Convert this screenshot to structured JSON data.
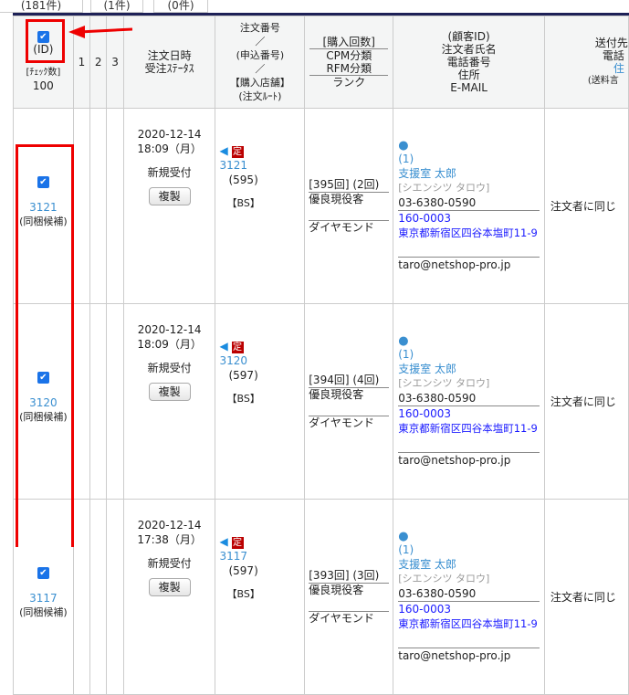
{
  "tabs": [
    {
      "count": "(181件)"
    },
    {
      "count": "(1件)"
    },
    {
      "count": "(0件)"
    }
  ],
  "header": {
    "check_id": "(ID)",
    "check_count_label": "[ﾁｪｯｸ数]",
    "check_count": "100",
    "col1": "1",
    "col2": "2",
    "col3": "3",
    "date_l1": "注文日時",
    "date_l2": "受注ｽﾃｰﾀｽ",
    "ord_l1": "注文番号",
    "ord_sep": "／",
    "ord_l2": "(申込番号)",
    "ord_l3": "【購入店舗】",
    "ord_l4": "(注文ﾙｰﾄ)",
    "buy_l1": "[購入回数]",
    "buy_l2": "CPM分類",
    "buy_l3": "RFM分類",
    "buy_l4": "ランク",
    "cust_l1": "(顧客ID)",
    "cust_l2": "注文者氏名",
    "cust_l3": "電話番号",
    "cust_l4": "住所",
    "cust_l5": "E-MAIL",
    "ship_l1": "送付先",
    "ship_l2": "電話",
    "ship_l3": "住",
    "ship_l4": "(送料言"
  },
  "rows": [
    {
      "id": "3121",
      "bundle": "(同梱候補)",
      "date": "2020-12-14",
      "time": "18:09（月）",
      "status": "新規受付",
      "copy": "複製",
      "tei": "定",
      "order_no": "3121",
      "app_no": "(595)",
      "store": "【BS】",
      "buy_count": "[395回] (2回)",
      "cpm": "優良現役客",
      "rank": "ダイヤモンド",
      "cust_id": "(1)",
      "name": "支援室 太郎",
      "kana": "[シエンシツ タロウ]",
      "tel": "03-6380-0590",
      "zip": "160-0003",
      "addr": "東京都新宿区四谷本塩町11-9",
      "email": "taro@netshop-pro.jp",
      "ship": "注文者に同じ"
    },
    {
      "id": "3120",
      "bundle": "(同梱候補)",
      "date": "2020-12-14",
      "time": "18:09（月）",
      "status": "新規受付",
      "copy": "複製",
      "tei": "定",
      "order_no": "3120",
      "app_no": "(597)",
      "store": "【BS】",
      "buy_count": "[394回] (4回)",
      "cpm": "優良現役客",
      "rank": "ダイヤモンド",
      "cust_id": "(1)",
      "name": "支援室 太郎",
      "kana": "[シエンシツ タロウ]",
      "tel": "03-6380-0590",
      "zip": "160-0003",
      "addr": "東京都新宿区四谷本塩町11-9",
      "email": "taro@netshop-pro.jp",
      "ship": "注文者に同じ"
    },
    {
      "id": "3117",
      "bundle": "(同梱候補)",
      "date": "2020-12-14",
      "time": "17:38（月）",
      "status": "新規受付",
      "copy": "複製",
      "tei": "定",
      "order_no": "3117",
      "app_no": "(597)",
      "store": "【BS】",
      "buy_count": "[393回] (3回)",
      "cpm": "優良現役客",
      "rank": "ダイヤモンド",
      "cust_id": "(1)",
      "name": "支援室 太郎",
      "kana": "[シエンシツ タロウ]",
      "tel": "03-6380-0590",
      "zip": "160-0003",
      "addr": "東京都新宿区四谷本塩町11-9",
      "email": "taro@netshop-pro.jp",
      "ship": "注文者に同じ"
    }
  ]
}
